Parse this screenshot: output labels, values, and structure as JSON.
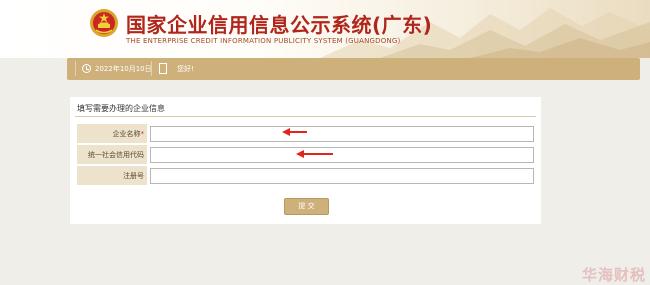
{
  "header": {
    "title_cn": "国家企业信用信息公示系统(广东)",
    "title_en": "THE ENTERPRISE CREDIT INFORMATION PUBLICITY SYSTEM (GUANGDONG)",
    "emblem_icon": "national-emblem-icon",
    "title_color": "#b1251b"
  },
  "navbar": {
    "date": "2022年10月10日",
    "greeting": "您好!",
    "color": "#cdb07a"
  },
  "form": {
    "section_title": "填写需要办理的企业信息",
    "fields": [
      {
        "label": "企业名称",
        "required_mark": "*",
        "value": "",
        "placeholder": ""
      },
      {
        "label": "统一社会信用代码",
        "value": "",
        "placeholder": ""
      },
      {
        "label": "注册号",
        "value": "",
        "placeholder": ""
      }
    ],
    "submit_label": "提 交"
  },
  "annotations": {
    "arrow_color": "#e0261b",
    "arrow_icon": "red-arrow-icon"
  },
  "watermark": {
    "text": "华海财税"
  }
}
